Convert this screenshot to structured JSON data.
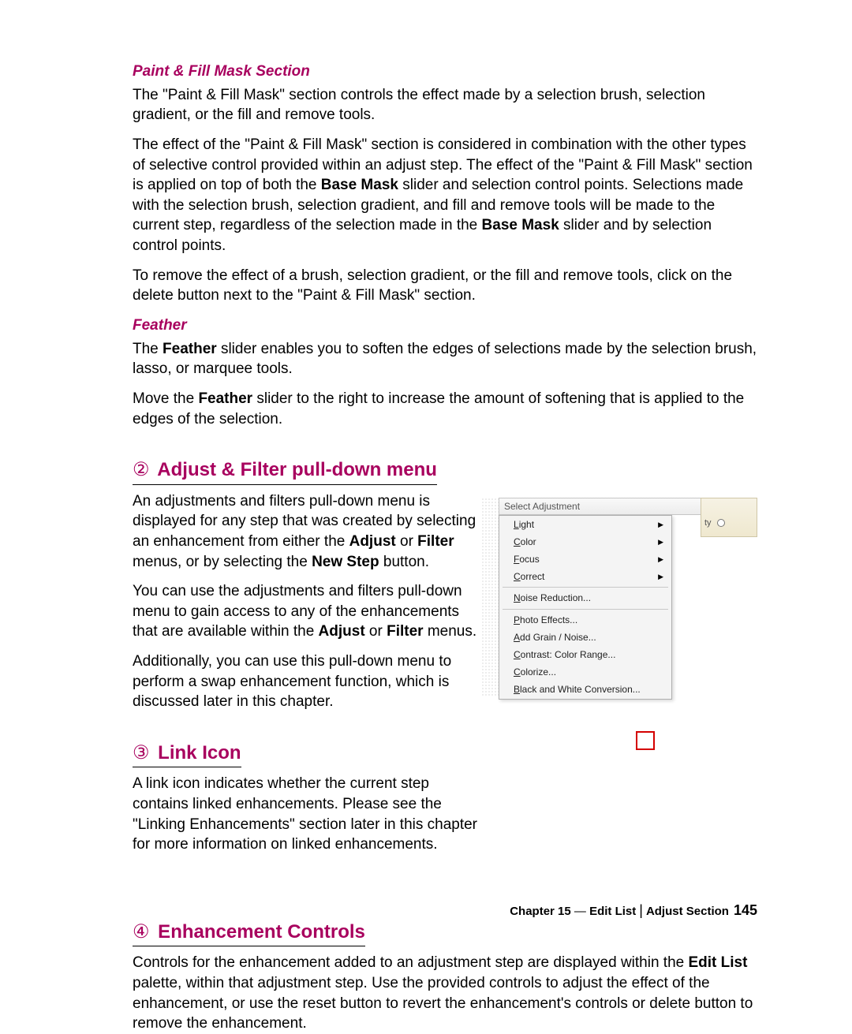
{
  "sections": {
    "paint_fill": {
      "heading": "Paint & Fill Mask Section",
      "p1_a": "The \"Paint & Fill Mask\" section controls the effect made by a selection brush, selection gradient, or the fill and remove tools.",
      "p2_a": "The effect of the \"Paint & Fill Mask\" section is considered in combination with the other types of selective control provided within an adjust step. The effect of the \"Paint & Fill Mask\" section is applied on top of both the ",
      "p2_b": "Base Mask",
      "p2_c": " slider and selection control points. Selections made with the selection brush, selection gradient, and fill and remove tools will be made to the current step, regardless of the selection made in the ",
      "p2_d": "Base Mask",
      "p2_e": " slider and by selection control points.",
      "p3": "To remove the effect of a brush, selection gradient, or the fill and remove tools, click on the delete button next to the \"Paint & Fill Mask\" section."
    },
    "feather": {
      "heading": "Feather",
      "p1_a": "The ",
      "p1_b": "Feather",
      "p1_c": " slider enables you to soften the edges of selections made by the selection brush, lasso, or marquee tools.",
      "p2_a": "Move the ",
      "p2_b": "Feather",
      "p2_c": " slider to the right to increase the amount of softening that is applied to the edges of the selection."
    },
    "adjust_filter": {
      "num": "②",
      "title": " Adjust & Filter pull-down menu",
      "p1_a": "An adjustments and filters pull-down menu is displayed for any step that was created by selecting an enhancement from either the ",
      "p1_b": "Adjust",
      "p1_c": " or ",
      "p1_d": "Filter",
      "p1_e": " menus, or by selecting the ",
      "p1_f": "New Step",
      "p1_g": " button.",
      "p2_a": "You can use the adjustments and filters pull-down menu to gain access to any of the enhancements that are available within the ",
      "p2_b": "Adjust",
      "p2_c": " or ",
      "p2_d": "Filter",
      "p2_e": " menus.",
      "p3": "Additionally, you can use this pull-down menu to perform a swap enhancement function, which is discussed later in this chapter."
    },
    "link_icon": {
      "num": "③",
      "title": " Link Icon",
      "p1": "A link icon indicates whether the current step contains linked enhancements. Please see the \"Linking Enhancements\" section later in this chapter for more information on linked enhancements."
    },
    "enhancement": {
      "num": "④",
      "title": " Enhancement Controls",
      "p1_a": "Controls for the enhancement added to an adjustment step are displayed within the ",
      "p1_b": "Edit List",
      "p1_c": " palette, within that adjustment step. Use the provided controls to adjust the effect of the enhancement, or use the reset button to revert the enhancement's controls or delete button to remove the enhancement."
    }
  },
  "menu": {
    "title": "Select Adjustment",
    "side_text": "ty",
    "items_sub": [
      {
        "label_pre": "L",
        "label_rest": "ight"
      },
      {
        "label_pre": "C",
        "label_rest": "olor"
      },
      {
        "label_pre": "F",
        "label_rest": "ocus"
      },
      {
        "label_pre": "C",
        "label_rest": "orrect"
      }
    ],
    "items_plain": [
      {
        "label_pre": "N",
        "label_rest": "oise Reduction..."
      },
      {
        "label_pre": "P",
        "label_rest": "hoto Effects..."
      },
      {
        "label_pre": "A",
        "label_rest": "dd Grain / Noise..."
      },
      {
        "label_pre": "C",
        "label_rest": "ontrast: Color Range..."
      },
      {
        "label_pre": "C",
        "label_rest": "olorize..."
      },
      {
        "label_pre": "B",
        "label_rest": "lack and White Conversion..."
      }
    ],
    "check": "✓",
    "arrow_down": "▼",
    "arrow_right": "▶"
  },
  "footer": {
    "chapter": "Chapter 15",
    "dash": " — ",
    "a": "Edit List",
    "b": "Adjust Section",
    "page": "145"
  }
}
